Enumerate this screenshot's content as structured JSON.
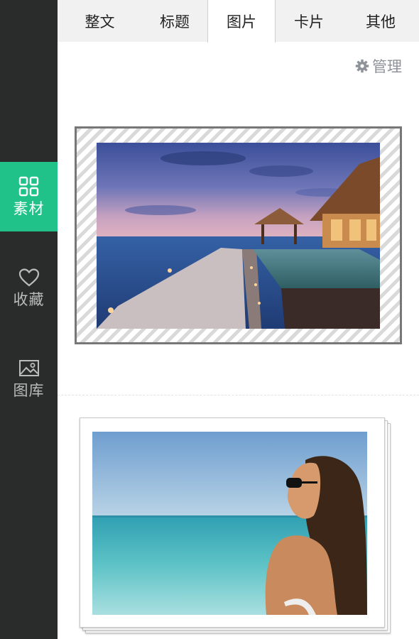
{
  "sidebar": {
    "items": [
      {
        "label": "素材",
        "icon": "grid-icon",
        "active": true
      },
      {
        "label": "收藏",
        "icon": "heart-icon",
        "active": false
      },
      {
        "label": "图库",
        "icon": "image-icon",
        "active": false
      }
    ]
  },
  "tabs": [
    {
      "label": "整文",
      "active": false
    },
    {
      "label": "标题",
      "active": false
    },
    {
      "label": "图片",
      "active": true
    },
    {
      "label": "卡片",
      "active": false
    },
    {
      "label": "其他",
      "active": false
    }
  ],
  "toolbar": {
    "manage_label": "管理",
    "manage_icon": "gear-icon"
  },
  "colors": {
    "accent": "#21c28a",
    "sidebar_bg": "#2a2c2b",
    "tab_bg": "#f1f1f1"
  }
}
